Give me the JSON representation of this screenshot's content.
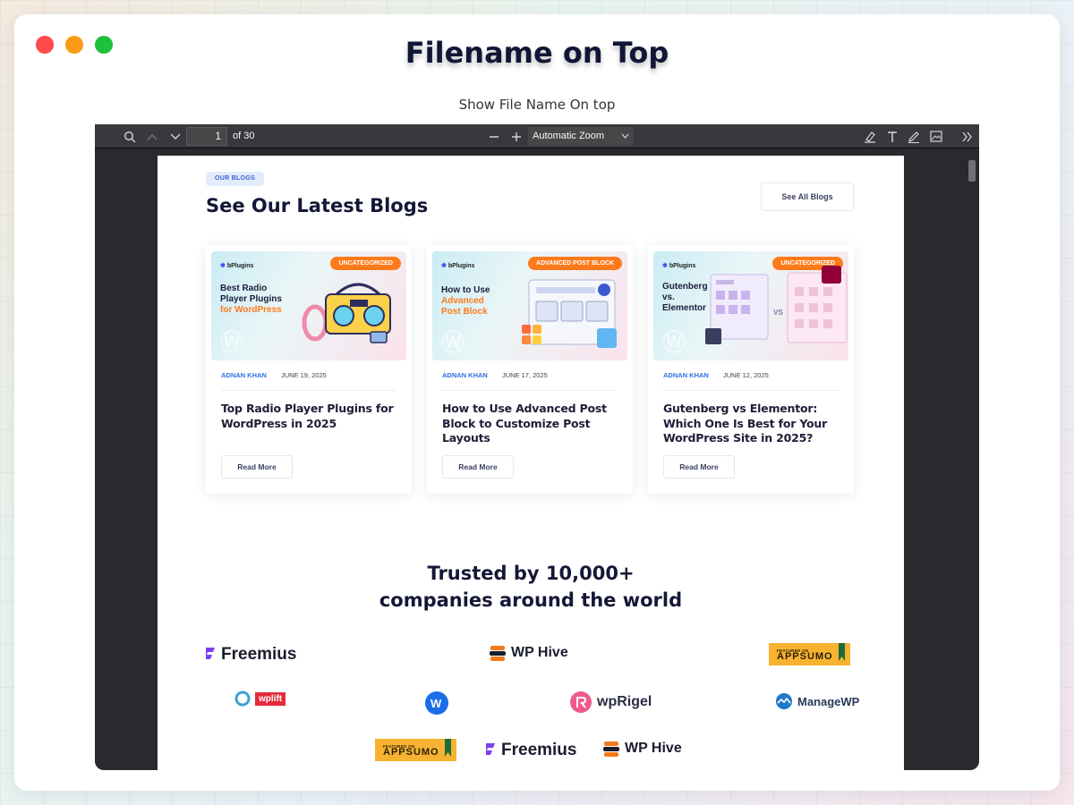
{
  "window": {
    "title": "Filename on Top",
    "subtitle": "Show File Name On top"
  },
  "toolbar": {
    "page_current": "1",
    "page_total_label": "of 30",
    "zoom_label": "Automatic Zoom",
    "icons": [
      "search-icon",
      "chevron-up-icon",
      "chevron-down-icon",
      "zoom-out-icon",
      "zoom-in-icon",
      "highlight-icon",
      "text-icon",
      "draw-icon",
      "image-icon",
      "double-chevron-right-icon"
    ]
  },
  "page": {
    "pill": "OUR BLOGS",
    "heading": "See Our Latest Blogs",
    "see_all": "See All Blogs",
    "cards": [
      {
        "brand": "bPlugins",
        "badge": "UNCATEGORIZED",
        "img_line1": "Best Radio",
        "img_line2": "Player Plugins",
        "img_highlight": "for WordPress",
        "author": "ADNAN KHAN",
        "date": "JUNE 19, 2025",
        "title": "Top Radio Player Plugins for WordPress in 2025",
        "cta": "Read More"
      },
      {
        "brand": "bPlugins",
        "badge": "ADVANCED POST BLOCK",
        "img_line1": "How to Use",
        "img_line2": "",
        "img_highlight": "Advanced Post Block",
        "author": "ADNAN KHAN",
        "date": "JUNE 17, 2025",
        "title": "How to Use Advanced Post Block to Customize Post Layouts",
        "cta": "Read More"
      },
      {
        "brand": "bPlugins",
        "badge": "UNCATEGORIZED",
        "img_line1": "Gutenberg",
        "img_line2": "vs.",
        "img_highlight": "Elementor",
        "author": "ADNAN KHAN",
        "date": "JUNE 12, 2025",
        "title": "Gutenberg vs Elementor: Which One Is Best for Your WordPress Site in 2025?",
        "cta": "Read More"
      }
    ],
    "trusted_line1": "Trusted by 10,000+",
    "trusted_line2": "companies around the world",
    "logos": {
      "freemius": "Freemius",
      "wphive": "WP Hive",
      "appsumo_small": "FEATURED ON",
      "appsumo": "APPSUMO",
      "wplift": "wplift",
      "wprigel": "wpRigel",
      "managewp": "ManageWP"
    }
  },
  "colors": {
    "accent": "#ff7a1a",
    "link": "#2f6fe0",
    "viewer_bg": "#2a2a2e",
    "toolbar_bg": "#38383d"
  }
}
